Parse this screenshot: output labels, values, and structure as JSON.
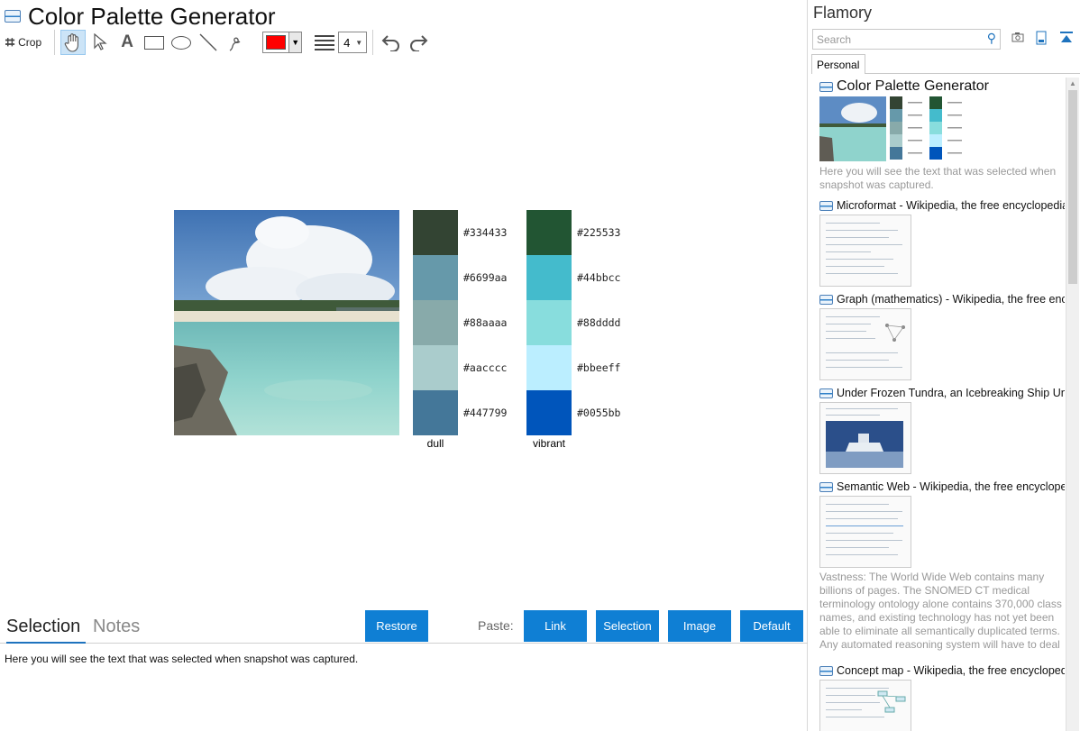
{
  "app": {
    "title": "Color Palette Generator"
  },
  "toolbar": {
    "crop_label": "Crop",
    "line_width": "4",
    "color": "#ff0000"
  },
  "canvas": {
    "palettes": [
      {
        "label": "dull",
        "colors": [
          "#334433",
          "#6699aa",
          "#88aaaa",
          "#aacccc",
          "#447799"
        ]
      },
      {
        "label": "vibrant",
        "colors": [
          "#225533",
          "#44bbcc",
          "#88dddd",
          "#bbeeff",
          "#0055bb"
        ]
      }
    ]
  },
  "bottom": {
    "tab_selection": "Selection",
    "tab_notes": "Notes",
    "restore_label": "Restore",
    "paste_label": "Paste:",
    "paste_buttons": [
      "Link",
      "Selection",
      "Image",
      "Default"
    ],
    "selection_text": "Here you will see the text that was selected when snapshot was captured."
  },
  "sidebar": {
    "brand": "Flamory",
    "search_placeholder": "Search",
    "tab": "Personal",
    "entries": [
      {
        "title": "Color Palette Generator",
        "snippet": "Here you will see the text that was selected when snapshot was captured."
      },
      {
        "title": "Microformat - Wikipedia, the free encyclopedia",
        "snippet": ""
      },
      {
        "title": "Graph (mathematics) - Wikipedia, the free encyc",
        "snippet": ""
      },
      {
        "title": "Under Frozen Tundra, an Icebreaking Ship Unco",
        "snippet": ""
      },
      {
        "title": "Semantic Web - Wikipedia, the free encycloped",
        "snippet": "Vastness: The World Wide Web contains many billions of pages. The SNOMED CT medical terminology ontology alone contains 370,000 class names, and existing technology has not yet been able to eliminate all semantically duplicated terms. Any automated reasoning system will have to deal with truly huge inputs."
      },
      {
        "title": "Concept map - Wikipedia, the free encyclopedi",
        "snippet": ""
      }
    ]
  }
}
